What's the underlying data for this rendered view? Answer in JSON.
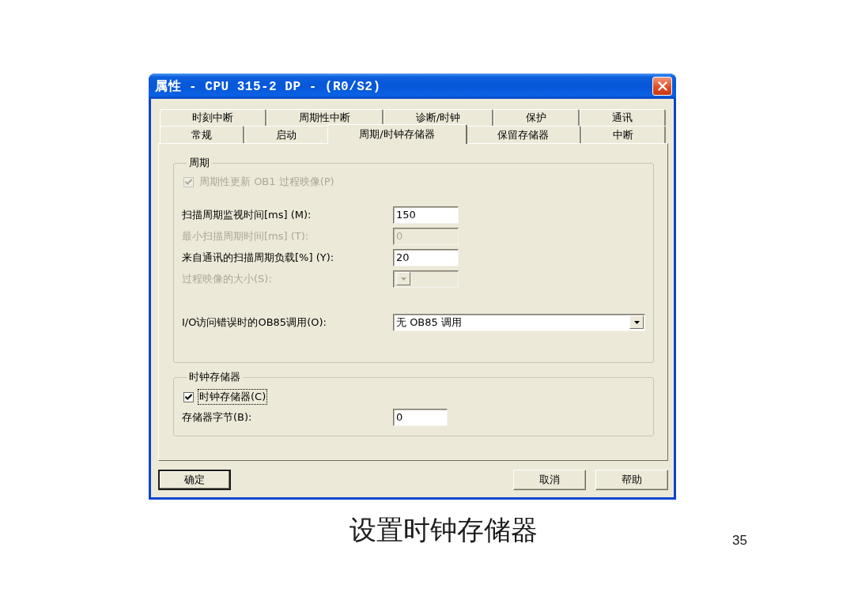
{
  "window": {
    "title": "属性 - CPU 315-2 DP - (R0/S2)"
  },
  "tab_rows": [
    [
      {
        "label": "时刻中断",
        "selected": false
      },
      {
        "label": "周期性中断",
        "selected": false
      },
      {
        "label": "诊断/时钟",
        "selected": false
      },
      {
        "label": "保护",
        "selected": false
      },
      {
        "label": "通讯",
        "selected": false
      }
    ],
    [
      {
        "label": "常规",
        "selected": false
      },
      {
        "label": "启动",
        "selected": false
      },
      {
        "label": "周期/时钟存储器",
        "selected": true
      },
      {
        "label": "保留存储器",
        "selected": false
      },
      {
        "label": "中断",
        "selected": false
      }
    ]
  ],
  "groups": [
    {
      "title": "周期",
      "rows": [
        {
          "kind": "checkbox",
          "label": "周期性更新 OB1 过程映像(P)",
          "checked": true,
          "disabled": true,
          "focused": false
        },
        {
          "kind": "text",
          "label": "扫描周期监视时间[ms] (M):",
          "value": "150",
          "disabled": false
        },
        {
          "kind": "text",
          "label": "最小扫描周期时间[ms] (T):",
          "value": "0",
          "disabled": true
        },
        {
          "kind": "text",
          "label": "来自通讯的扫描周期负载[%] (Y):",
          "value": "20",
          "disabled": false
        },
        {
          "kind": "dropdown",
          "label": "过程映像的大小(S):",
          "disabled": true
        },
        {
          "kind": "dropdown",
          "label": "I/O访问错误时的OB85调用(O):",
          "value": "无 OB85 调用",
          "disabled": false
        }
      ]
    },
    {
      "title": "时钟存储器",
      "rows": [
        {
          "kind": "checkbox",
          "label": "时钟存储器(C)",
          "checked": true,
          "disabled": false,
          "focused": true
        },
        {
          "kind": "text",
          "label": "存储器字节(B):",
          "value": "0",
          "disabled": false
        }
      ]
    }
  ],
  "buttons": [
    {
      "label": "确定",
      "default": true
    },
    {
      "label": "取消",
      "default": false
    },
    {
      "label": "帮助",
      "default": false
    }
  ],
  "caption": "设置时钟存储器",
  "page_number": "35"
}
